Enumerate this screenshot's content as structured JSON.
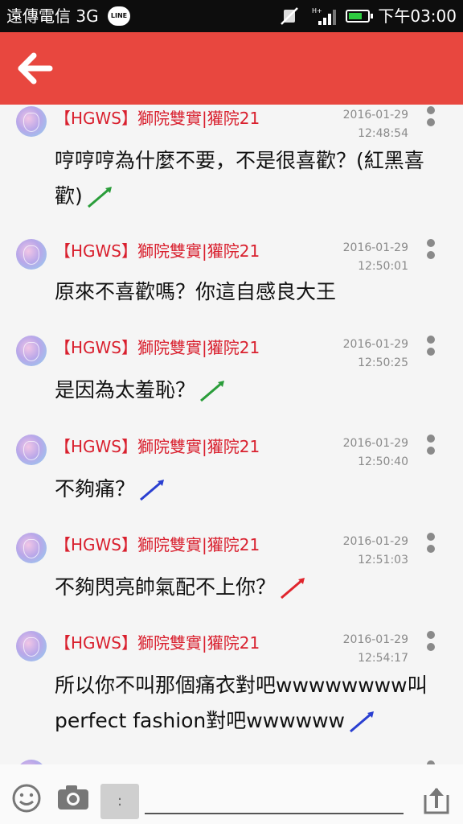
{
  "status_bar": {
    "carrier": "遠傳電信 3G",
    "line_badge": "LINE",
    "network": "H+",
    "time": "下午03:00"
  },
  "colors": {
    "app_bar": "#e8473f",
    "sender_name": "#d9202e",
    "timestamp": "#8a8a8a"
  },
  "messages": [
    {
      "sender": "【HGWS】獅院雙實|獾院21",
      "date": "2016-01-29",
      "time": "12:48:54",
      "text": "哼哼哼為什麼不要，不是很喜歡？(紅黑喜歡)",
      "emoticon": "green-horn-icon"
    },
    {
      "sender": "【HGWS】獅院雙實|獾院21",
      "date": "2016-01-29",
      "time": "12:50:01",
      "text": "原來不喜歡嗎？你這自感良大王",
      "emoticon": ""
    },
    {
      "sender": "【HGWS】獅院雙實|獾院21",
      "date": "2016-01-29",
      "time": "12:50:25",
      "text": "是因為太羞恥？",
      "emoticon": "green-horn-icon"
    },
    {
      "sender": "【HGWS】獅院雙實|獾院21",
      "date": "2016-01-29",
      "time": "12:50:40",
      "text": "不夠痛？",
      "emoticon": "blue-horn-icon"
    },
    {
      "sender": "【HGWS】獅院雙實|獾院21",
      "date": "2016-01-29",
      "time": "12:51:03",
      "text": "不夠閃亮帥氣配不上你？",
      "emoticon": "red-horn-icon"
    },
    {
      "sender": "【HGWS】獅院雙實|獾院21",
      "date": "2016-01-29",
      "time": "12:54:17",
      "text": "所以你不叫那個痛衣對吧wwwwwwww叫perfect fashion對吧wwwwww",
      "emoticon": "blue-horn-icon"
    }
  ],
  "input_bar": {
    "sticker_label": ":",
    "input_value": ""
  }
}
